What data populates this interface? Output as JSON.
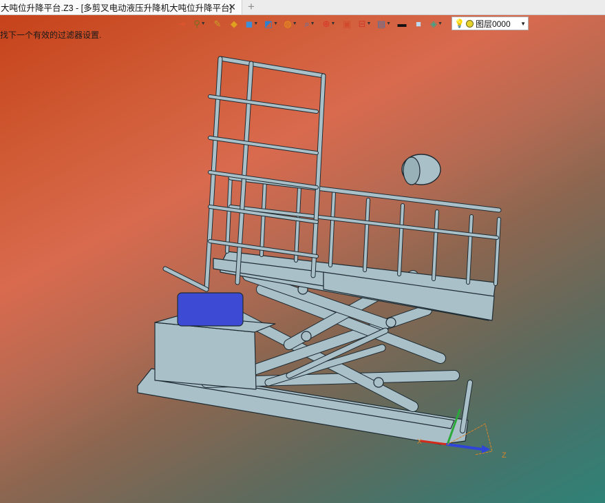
{
  "tab": {
    "title": "大吨位升降平台.Z3 - [多剪叉电动液压升降机大吨位升降平台]",
    "close_glyph": "✕",
    "new_tab_glyph": "+"
  },
  "status": {
    "message": "找下一个有效的过滤器设置."
  },
  "toolbar": {
    "tools": [
      {
        "name": "exit-icon",
        "glyph": "⇥",
        "color": "#e2552e",
        "dropdown": false
      },
      {
        "name": "pick-filter-icon",
        "glyph": "⚲",
        "color": "#7a6b20",
        "dropdown": true
      },
      {
        "name": "pen-icon",
        "glyph": "✎",
        "color": "#c9a428",
        "dropdown": false
      },
      {
        "name": "shaded-box-icon",
        "glyph": "◆",
        "color": "#e0a21e",
        "dropdown": false
      },
      {
        "name": "solid-cube-icon",
        "glyph": "◼",
        "color": "#3a8fd8",
        "dropdown": true
      },
      {
        "name": "view-cube-icon",
        "glyph": "◩",
        "color": "#2f7fcf",
        "dropdown": true
      },
      {
        "name": "view-rotate-icon",
        "glyph": "◍",
        "color": "#e99418",
        "dropdown": true
      },
      {
        "name": "zoom-icon",
        "glyph": "⌕",
        "color": "#3a78c8",
        "dropdown": true
      },
      {
        "name": "origin-icon",
        "glyph": "⊕",
        "color": "#d9352a",
        "dropdown": true
      },
      {
        "name": "section-icon",
        "glyph": "▣",
        "color": "#d24a2e",
        "dropdown": false
      },
      {
        "name": "frame-icon",
        "glyph": "⊟",
        "color": "#cf3a2a",
        "dropdown": true
      },
      {
        "name": "display-icon",
        "glyph": "▤",
        "color": "#4a72a8",
        "dropdown": true
      },
      {
        "name": "line-style-icon",
        "glyph": "▬",
        "color": "#111111",
        "dropdown": false
      },
      {
        "name": "fill-color-icon",
        "glyph": "■",
        "color": "#bcd9ef",
        "dropdown": false
      },
      {
        "name": "layers-icon",
        "glyph": "◈",
        "color": "#3aa58a",
        "dropdown": true
      }
    ],
    "layer": {
      "bulb_glyph": "💡",
      "name": "图层0000",
      "arrow_glyph": "▼"
    }
  },
  "colors": {
    "part": "#a9c0c8",
    "edge": "#1d2a32",
    "hydraulic": "#3d4bd4",
    "axis_x": "#d22b1c",
    "axis_y": "#2aa83a",
    "axis_z": "#2f45d8",
    "axis_frame": "#d8832a"
  },
  "axes": {
    "x_label": "X",
    "z_label": "Z"
  }
}
